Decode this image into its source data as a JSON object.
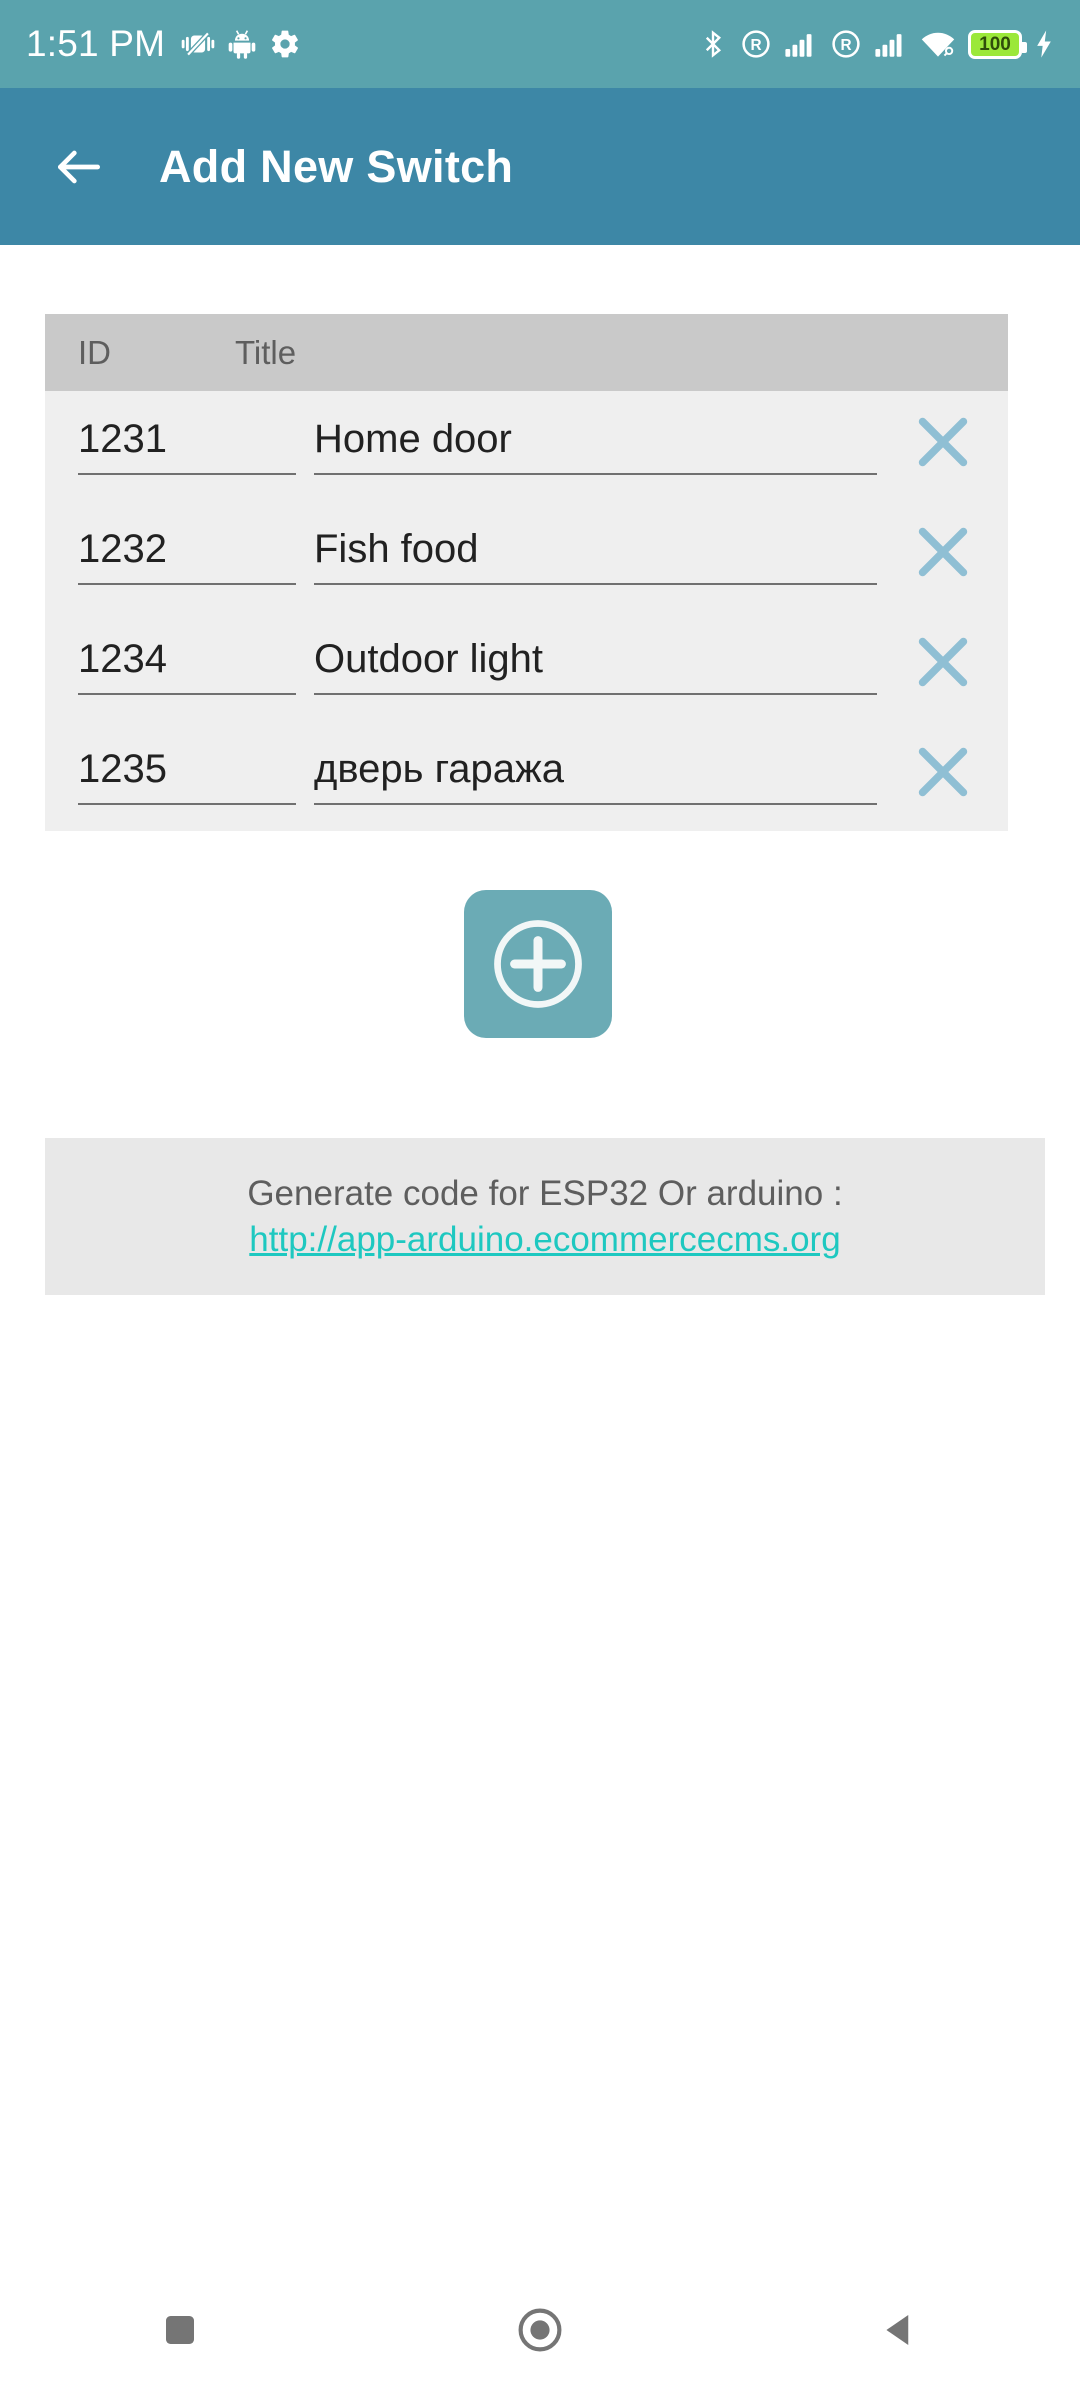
{
  "status_bar": {
    "time": "1:51 PM",
    "battery_level": "100",
    "bg_color": "#5aa3ad",
    "left_icons": [
      "vibrate-off-icon",
      "android-icon",
      "gear-icon"
    ],
    "right_icons": [
      "bluetooth-icon",
      "r-circle-icon",
      "signal-bars-icon",
      "r-circle-icon",
      "signal-bars-icon",
      "wifi-icon",
      "battery-icon",
      "charging-bolt-icon"
    ]
  },
  "app_bar": {
    "title": "Add New Switch",
    "back_icon": "arrow-left-icon",
    "bg_color": "#3d87a6"
  },
  "table": {
    "columns": [
      "ID",
      "Title"
    ],
    "delete_icon": "close-x-icon",
    "rows": [
      {
        "id": "1231",
        "title": "Home door"
      },
      {
        "id": "1232",
        "title": "Fish food"
      },
      {
        "id": "1234",
        "title": "Outdoor light"
      },
      {
        "id": "1235",
        "title": "дверь гаража"
      }
    ]
  },
  "add_button": {
    "icon": "plus-circle-icon",
    "bg_color": "#6babb5"
  },
  "banner": {
    "text": "Generate code for ESP32 Or arduino :",
    "link": "http://app-arduino.ecommercecms.org",
    "link_color": "#1ec8c0",
    "bg_color": "#e8e8e8"
  },
  "nav_bar": {
    "buttons": [
      "recents-square-icon",
      "home-circle-icon",
      "back-triangle-icon"
    ],
    "icon_color": "#757575"
  }
}
